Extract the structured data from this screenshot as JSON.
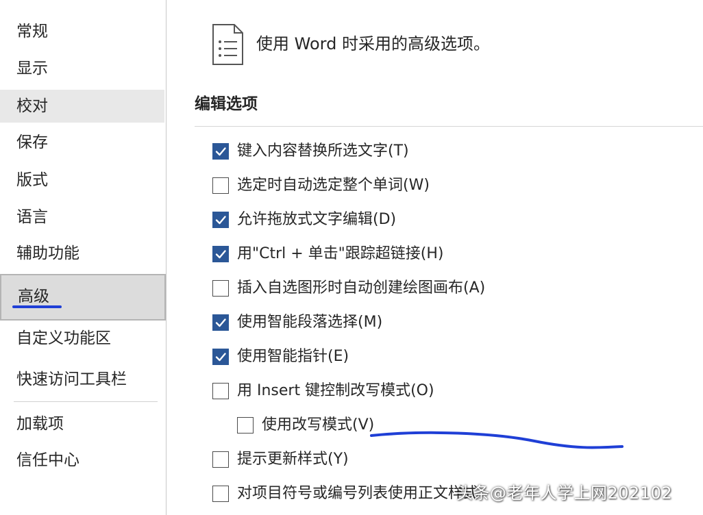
{
  "sidebar": {
    "items": [
      {
        "label": "常规"
      },
      {
        "label": "显示"
      },
      {
        "label": "校对"
      },
      {
        "label": "保存"
      },
      {
        "label": "版式"
      },
      {
        "label": "语言"
      },
      {
        "label": "辅助功能"
      },
      {
        "label": "高级"
      },
      {
        "label": "自定义功能区"
      },
      {
        "label": "快速访问工具栏"
      },
      {
        "label": "加载项"
      },
      {
        "label": "信任中心"
      }
    ],
    "selected": "高级",
    "hovered": "校对"
  },
  "main": {
    "header_icon": "document-list-icon",
    "title": "使用 Word 时采用的高级选项。",
    "section": {
      "title": "编辑选项",
      "options": [
        {
          "label": "键入内容替换所选文字(T)",
          "checked": true
        },
        {
          "label": "选定时自动选定整个单词(W)",
          "checked": false
        },
        {
          "label": "允许拖放式文字编辑(D)",
          "checked": true
        },
        {
          "label": "用\"Ctrl + 单击\"跟踪超链接(H)",
          "checked": true
        },
        {
          "label": "插入自选图形时自动创建绘图画布(A)",
          "checked": false
        },
        {
          "label": "使用智能段落选择(M)",
          "checked": true
        },
        {
          "label": "使用智能指针(E)",
          "checked": true
        },
        {
          "label": "用 Insert 键控制改写模式(O)",
          "checked": false
        },
        {
          "label": "使用改写模式(V)",
          "checked": false
        },
        {
          "label": "提示更新样式(Y)",
          "checked": false
        },
        {
          "label": "对项目符号或编号列表使用正文样式",
          "checked": false
        }
      ]
    }
  },
  "annotation_color": "#1f3fd6",
  "accent_color": "#2b5797",
  "watermark": "头条@老年人学上网202102"
}
